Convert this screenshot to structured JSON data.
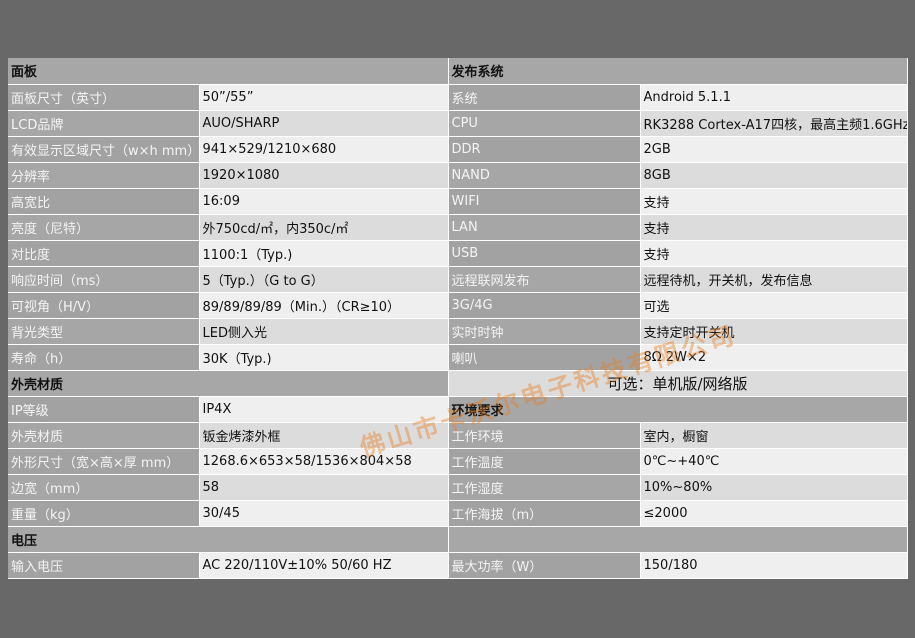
{
  "left": [
    {
      "type": "section",
      "label": "面板"
    },
    {
      "label": "面板尺寸（英寸）",
      "value": "50”/55”"
    },
    {
      "label": "LCD品牌",
      "value": "AUO/SHARP"
    },
    {
      "label": "有效显示区域尺寸（w×h mm）",
      "value": "941×529/1210×680"
    },
    {
      "label": "分辨率",
      "value": "1920×1080"
    },
    {
      "label": "高宽比",
      "value": "16:09"
    },
    {
      "label": "亮度（尼特）",
      "value": "外750cd/㎡，内350c/㎡"
    },
    {
      "label": "对比度",
      "value": "1100:1（Typ.)"
    },
    {
      "label": "响应时间（ms）",
      "value": "5（Typ.）（G to G）"
    },
    {
      "label": "可视角（H/V）",
      "value": "89/89/89/89（Min.）（CR≥10）"
    },
    {
      "label": "背光类型",
      "value": "LED侧入光"
    },
    {
      "label": "寿命（h）",
      "value": "30K（Typ.)"
    },
    {
      "type": "section",
      "label": "外壳材质"
    },
    {
      "label": "IP等级",
      "value": "IP4X"
    },
    {
      "label": "外壳材质",
      "value": "钣金烤漆外框"
    },
    {
      "label": "外形尺寸（宽×高×厚 mm）",
      "value": "1268.6×653×58/1536×804×58"
    },
    {
      "label": "边宽（mm）",
      "value": "58"
    },
    {
      "label": "重量（kg）",
      "value": "30/45"
    },
    {
      "type": "section",
      "label": "电压"
    },
    {
      "label": "输入电压",
      "value": "AC 220/110V±10%  50/60 HZ"
    }
  ],
  "right": [
    {
      "type": "section",
      "label": "发布系统"
    },
    {
      "label": "系统",
      "value": "Android 5.1.1"
    },
    {
      "label": "CPU",
      "value": "RK3288 Cortex-A17四核，最高主频1.6GHz"
    },
    {
      "label": "DDR",
      "value": "2GB"
    },
    {
      "label": "NAND",
      "value": "8GB"
    },
    {
      "label": "WIFI",
      "value": "支持"
    },
    {
      "label": "LAN",
      "value": "支持"
    },
    {
      "label": "USB",
      "value": "支持"
    },
    {
      "label": "远程联网发布",
      "value": "远程待机，开关机，发布信息"
    },
    {
      "label": "3G/4G",
      "value": "可选"
    },
    {
      "label": "实时时钟",
      "value": "支持定时开关机"
    },
    {
      "label": "喇叭",
      "value": "8Ω 2W×2"
    },
    {
      "type": "note",
      "label": "可选：单机版/网络版"
    },
    {
      "type": "section",
      "label": "环境要求"
    },
    {
      "label": "工作环境",
      "value": "室内，橱窗"
    },
    {
      "label": "工作温度",
      "value": "0℃~+40℃"
    },
    {
      "label": "工作湿度",
      "value": "10%~80%"
    },
    {
      "label": "工作海拔（m）",
      "value": "≤2000"
    },
    {
      "type": "blank"
    },
    {
      "label": "最大功率（W）",
      "value": "150/180"
    }
  ],
  "watermark": "佛山市卡沃尔电子科技有限公司"
}
